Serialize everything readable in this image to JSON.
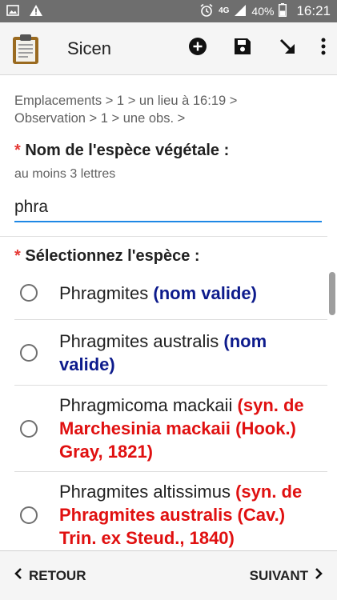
{
  "status_bar": {
    "battery": "40%",
    "time": "16:21",
    "network": "4G",
    "icons_left": [
      "image-icon",
      "warning-icon"
    ],
    "icons_right": [
      "alarm-icon",
      "signal-icon",
      "battery-icon"
    ]
  },
  "app_bar": {
    "title": "Sicen",
    "actions": [
      "add-icon",
      "save-icon",
      "arrow-down-right-icon",
      "more-vertical-icon"
    ]
  },
  "breadcrumb": {
    "line1": "Emplacements > 1 > un lieu à 16:19 >",
    "line2": "Observation > 1 > une obs.  >"
  },
  "form": {
    "required_mark": "*",
    "species_label": "Nom de l'espèce végétale :",
    "hint": "au moins 3 lettres",
    "input_value": "phra",
    "select_label": "Sélectionnez l'espèce :"
  },
  "options": [
    {
      "name": "Phragmites ",
      "qualifier": "(nom valide)",
      "type": "valid"
    },
    {
      "name": "Phragmites australis ",
      "qualifier": "(nom valide)",
      "type": "valid"
    },
    {
      "name": "Phragmicoma mackaii ",
      "qualifier": "(syn. de Marchesinia mackaii (Hook.) Gray, 1821)",
      "type": "syn"
    },
    {
      "name": "Phragmites altissimus ",
      "qualifier": "(syn. de Phragmites australis (Cav.) Trin. ex Steud., 1840)",
      "type": "syn"
    }
  ],
  "bottom_bar": {
    "back_label": "RETOUR",
    "next_label": "SUIVANT"
  },
  "colors": {
    "accent": "#1e88e5",
    "required": "#e53935",
    "valid": "#0d1b8c",
    "synonym": "#e01010",
    "status_bar": "#6e6e6e"
  }
}
